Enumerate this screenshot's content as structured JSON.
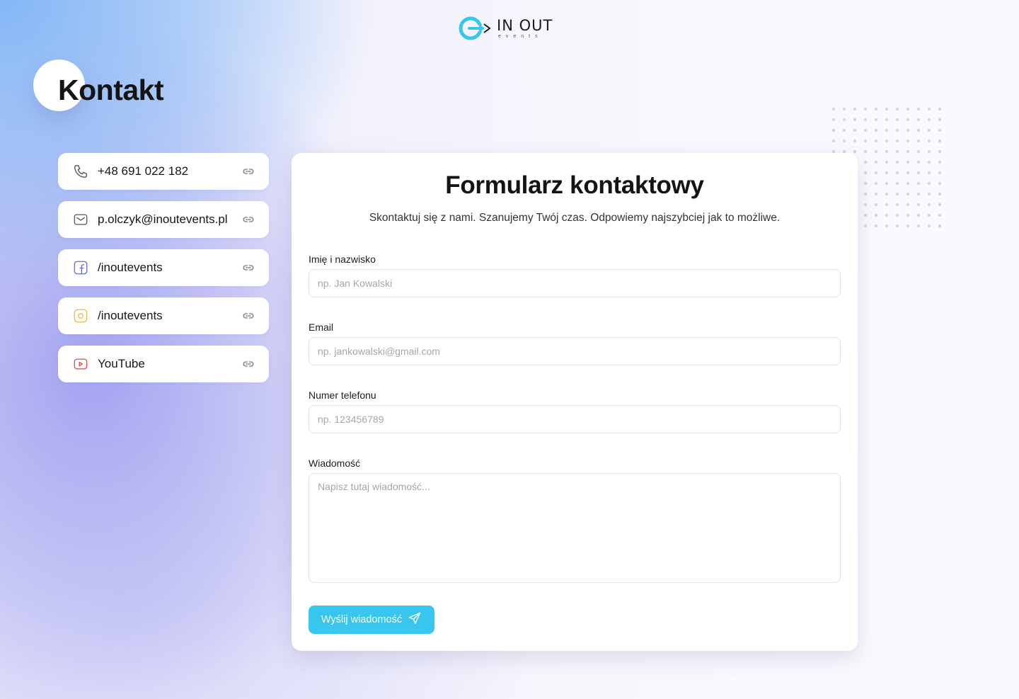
{
  "brand": {
    "name": "IN OUT",
    "subtitle": "events",
    "accent_color": "#38c6ee"
  },
  "page": {
    "title": "Kontakt"
  },
  "contacts": [
    {
      "icon": "phone-icon",
      "label": "+48 691 022 182",
      "icon_color": "#555555"
    },
    {
      "icon": "mail-icon",
      "label": "p.olczyk@inoutevents.pl",
      "icon_color": "#555555"
    },
    {
      "icon": "facebook-icon",
      "label": "/inoutevents",
      "icon_color": "#5b6cd8"
    },
    {
      "icon": "instagram-icon",
      "label": "/inoutevents",
      "icon_color": "#f0b43a"
    },
    {
      "icon": "youtube-icon",
      "label": "YouTube",
      "icon_color": "#e04646"
    }
  ],
  "form": {
    "title": "Formularz kontaktowy",
    "subtitle": "Skontaktuj się z nami. Szanujemy Twój czas. Odpowiemy najszybciej jak to możliwe.",
    "fields": {
      "name": {
        "label": "Imię i nazwisko",
        "placeholder": "np. Jan Kowalski",
        "value": ""
      },
      "email": {
        "label": "Email",
        "placeholder": "np. jankowalski@gmail.com",
        "value": ""
      },
      "phone": {
        "label": "Numer telefonu",
        "placeholder": "np. 123456789",
        "value": ""
      },
      "message": {
        "label": "Wiadomość",
        "placeholder": "Napisz tutaj wiadomość...",
        "value": ""
      }
    },
    "submit_label": "Wyślij wiadomość"
  }
}
